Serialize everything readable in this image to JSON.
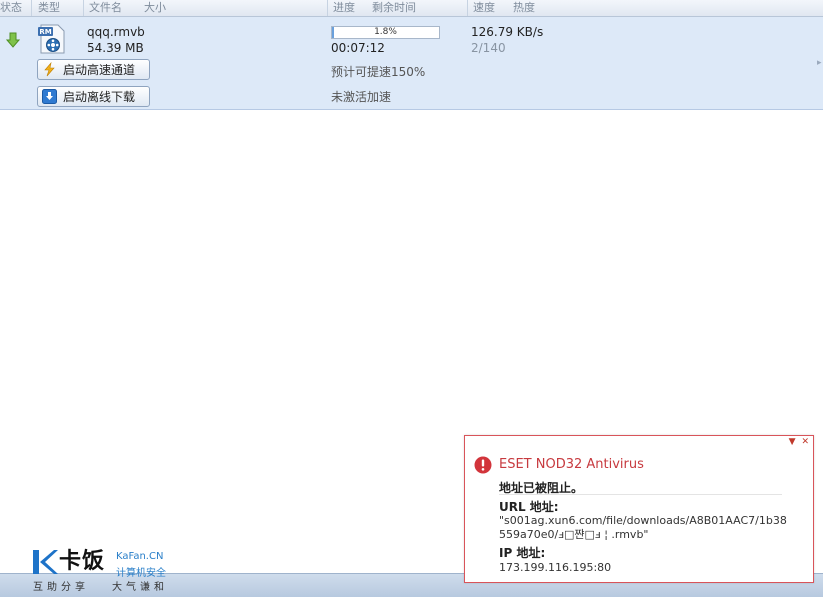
{
  "columns": {
    "status": "状态",
    "type": "类型",
    "filename": "文件名",
    "size": "大小",
    "progress": "进度",
    "remaining": "剩余时间",
    "speed": "速度",
    "heat": "热度"
  },
  "task": {
    "filename": "qqq.rmvb",
    "size": "54.39 MB",
    "progress_text": "1.8%",
    "progress_value": 0.018,
    "remaining": "00:07:12",
    "speed": "126.79 KB/s",
    "heat": "2/140",
    "speedup_note": "预计可提速150%",
    "accel_status": "未激活加速",
    "file_badge": "RM",
    "btn_high_speed": "启动高速通道",
    "btn_offline": "启动离线下载"
  },
  "logo": {
    "name": "卡饭",
    "site": "KaFan.CN",
    "subtitle": "计算机安全",
    "slogan_left": "互助分享",
    "slogan_right": "大气谦和"
  },
  "popup": {
    "title": "ESET NOD32 Antivirus",
    "blocked_text": "地址已被阻止。",
    "url_heading": "URL 地址:",
    "url_value": "\"s001ag.xun6.com/file/downloads/A8B01AAC7/1b38559a70e0/ⅎ□쨘□ⅎ ¦ .rmvb\"",
    "ip_heading": "IP 地址:",
    "ip_value": "173.199.116.195:80",
    "ctl_menu": "▼",
    "ctl_close": "✕"
  },
  "colors": {
    "selected_row": "#dde9f8",
    "accent_blue": "#2a7fc9",
    "eset_red": "#c73a3f"
  },
  "icons": {
    "status": "download-arrow-icon",
    "file_type": "rmvb-file-icon",
    "high_speed": "lightning-icon",
    "offline": "download-box-icon",
    "alert": "alert-icon"
  }
}
